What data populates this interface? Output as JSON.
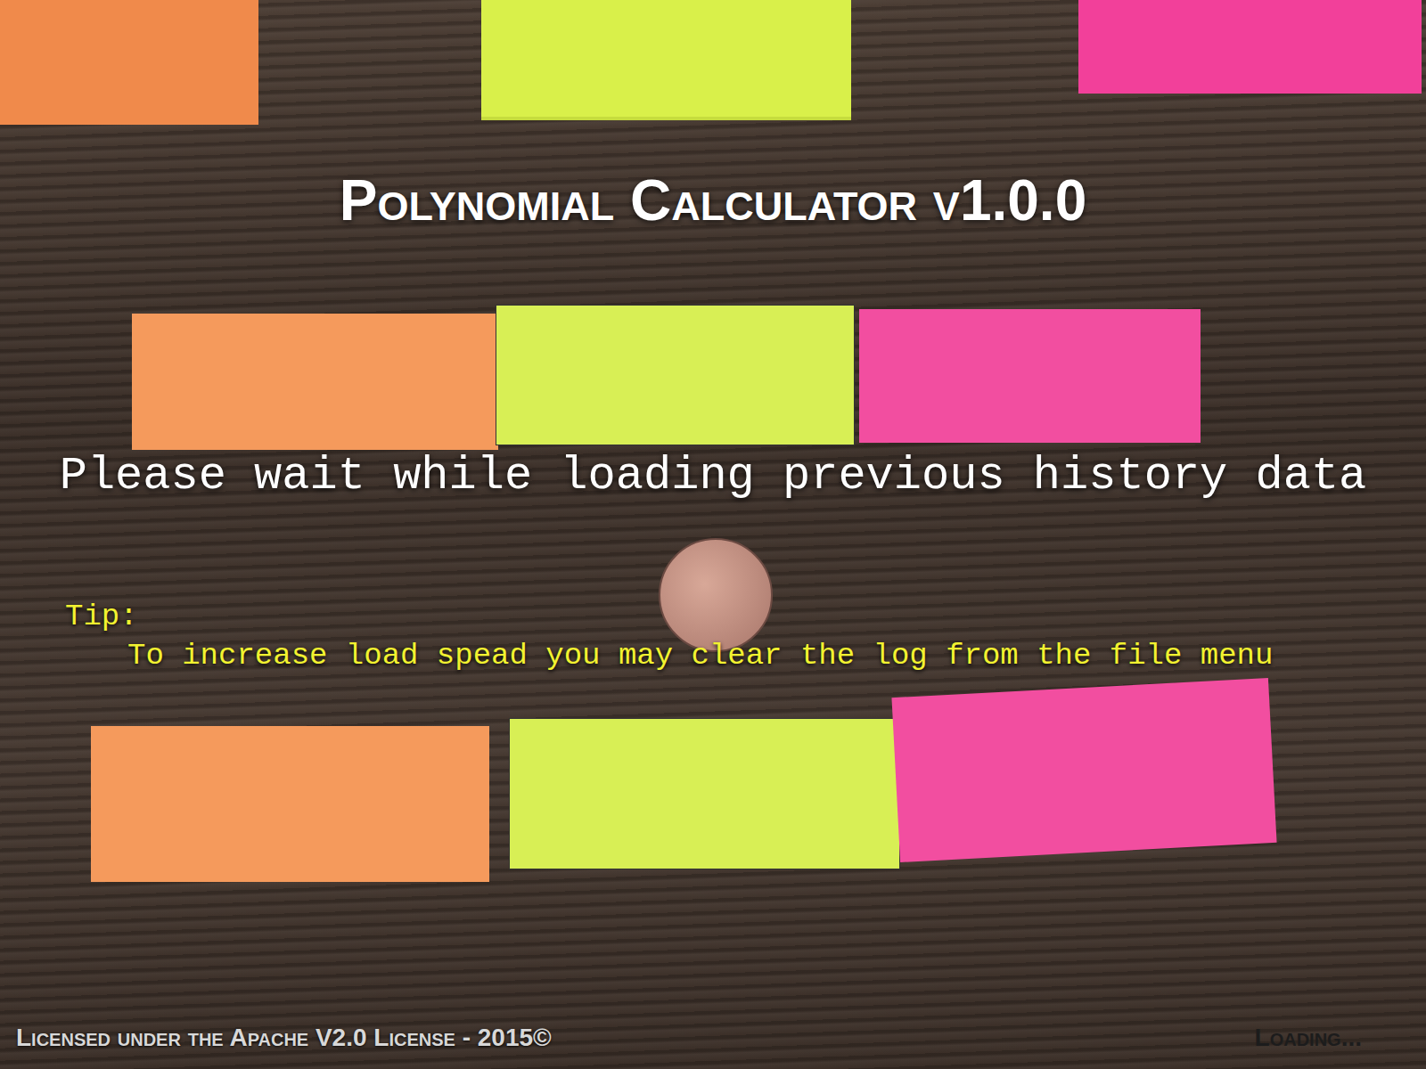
{
  "title": "Polynomial Calculator v1.0.0",
  "status_message": "Please wait while loading previous history data",
  "tip": {
    "label": "Tip:",
    "text": "To increase load spead you may clear the log from the file menu"
  },
  "footer": {
    "license": "Licensed under the Apache V2.0 License - 2015©",
    "status": "Loading..."
  }
}
